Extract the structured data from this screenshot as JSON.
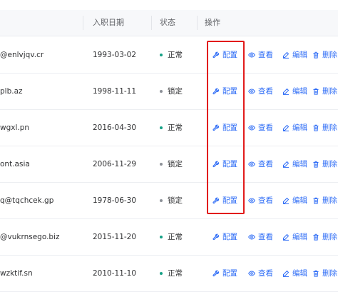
{
  "table": {
    "columns": {
      "hire_date": "入职日期",
      "status": "状态",
      "actions": "操作"
    },
    "action_labels": {
      "configure": "配置",
      "view": "查看",
      "edit": "编辑",
      "delete": "删除"
    },
    "rows": [
      {
        "email": "@enlvjqv.cr",
        "hire_date": "1993-03-02",
        "status": "正常",
        "status_color": "#14a085"
      },
      {
        "email": "plb.az",
        "hire_date": "1998-11-11",
        "status": "锁定",
        "status_color": "#8c9097"
      },
      {
        "email": "wgxl.pn",
        "hire_date": "2016-04-30",
        "status": "正常",
        "status_color": "#14a085"
      },
      {
        "email": "ont.asia",
        "hire_date": "2006-11-29",
        "status": "锁定",
        "status_color": "#8c9097"
      },
      {
        "email": "q@tqchcek.gp",
        "hire_date": "1978-06-30",
        "status": "锁定",
        "status_color": "#8c9097"
      },
      {
        "email": "@vukrnsego.biz",
        "hire_date": "2015-11-20",
        "status": "正常",
        "status_color": "#14a085"
      },
      {
        "email": "wzktif.sn",
        "hire_date": "2010-11-10",
        "status": "正常",
        "status_color": "#14a085"
      }
    ]
  },
  "colors": {
    "accent": "#2f6df6",
    "highlight_border": "#e21b1b",
    "header_bg": "#f7f8fa"
  },
  "icons": {
    "configure": "wrench-icon",
    "view": "eye-icon",
    "edit": "pencil-icon",
    "delete": "trash-icon"
  }
}
